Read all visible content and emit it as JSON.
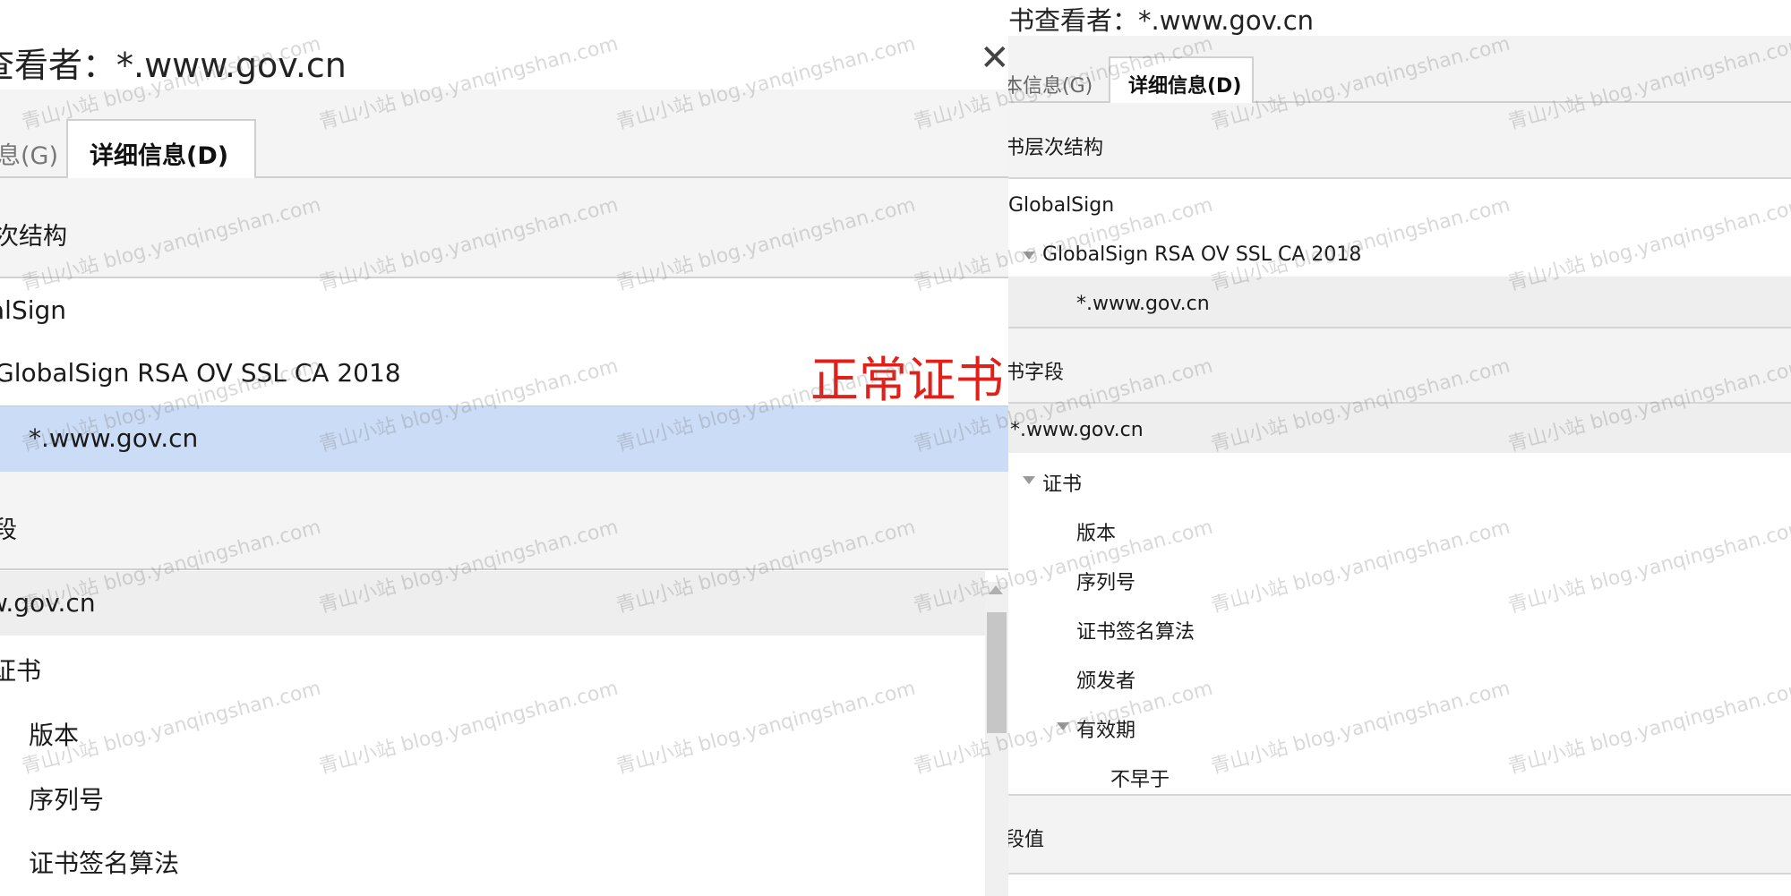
{
  "left": {
    "title": "查看者：*.www.gov.cn",
    "close_glyph": "✕",
    "tabs": {
      "general": "息(G)",
      "details": "详细信息(D)"
    },
    "hierarchy_label": "次结构",
    "hierarchy": {
      "root": "alSign",
      "intermediate": "GlobalSign RSA OV SSL CA 2018",
      "leaf": "*.www.gov.cn"
    },
    "fields_label": "段",
    "fields": {
      "root": "w.gov.cn",
      "cert": "证书",
      "items": [
        "版本",
        "序列号",
        "证书签名算法"
      ]
    }
  },
  "annotation": "正常证书",
  "right": {
    "title": "书查看者：*.www.gov.cn",
    "tabs": {
      "general": "本信息(G)",
      "details": "详细信息(D)"
    },
    "hierarchy_label": "书层次结构",
    "hierarchy": {
      "root": "GlobalSign",
      "intermediate": "GlobalSign RSA OV SSL CA 2018",
      "leaf": "*.www.gov.cn"
    },
    "fields_label": "书字段",
    "fields": {
      "root": "*.www.gov.cn",
      "cert": "证书",
      "items": [
        "版本",
        "序列号",
        "证书签名算法",
        "颁发者"
      ],
      "validity": "有效期",
      "not_before": "不早于"
    },
    "value_label": "段值"
  },
  "watermark": "青山小站 blog.yanqingshan.com"
}
